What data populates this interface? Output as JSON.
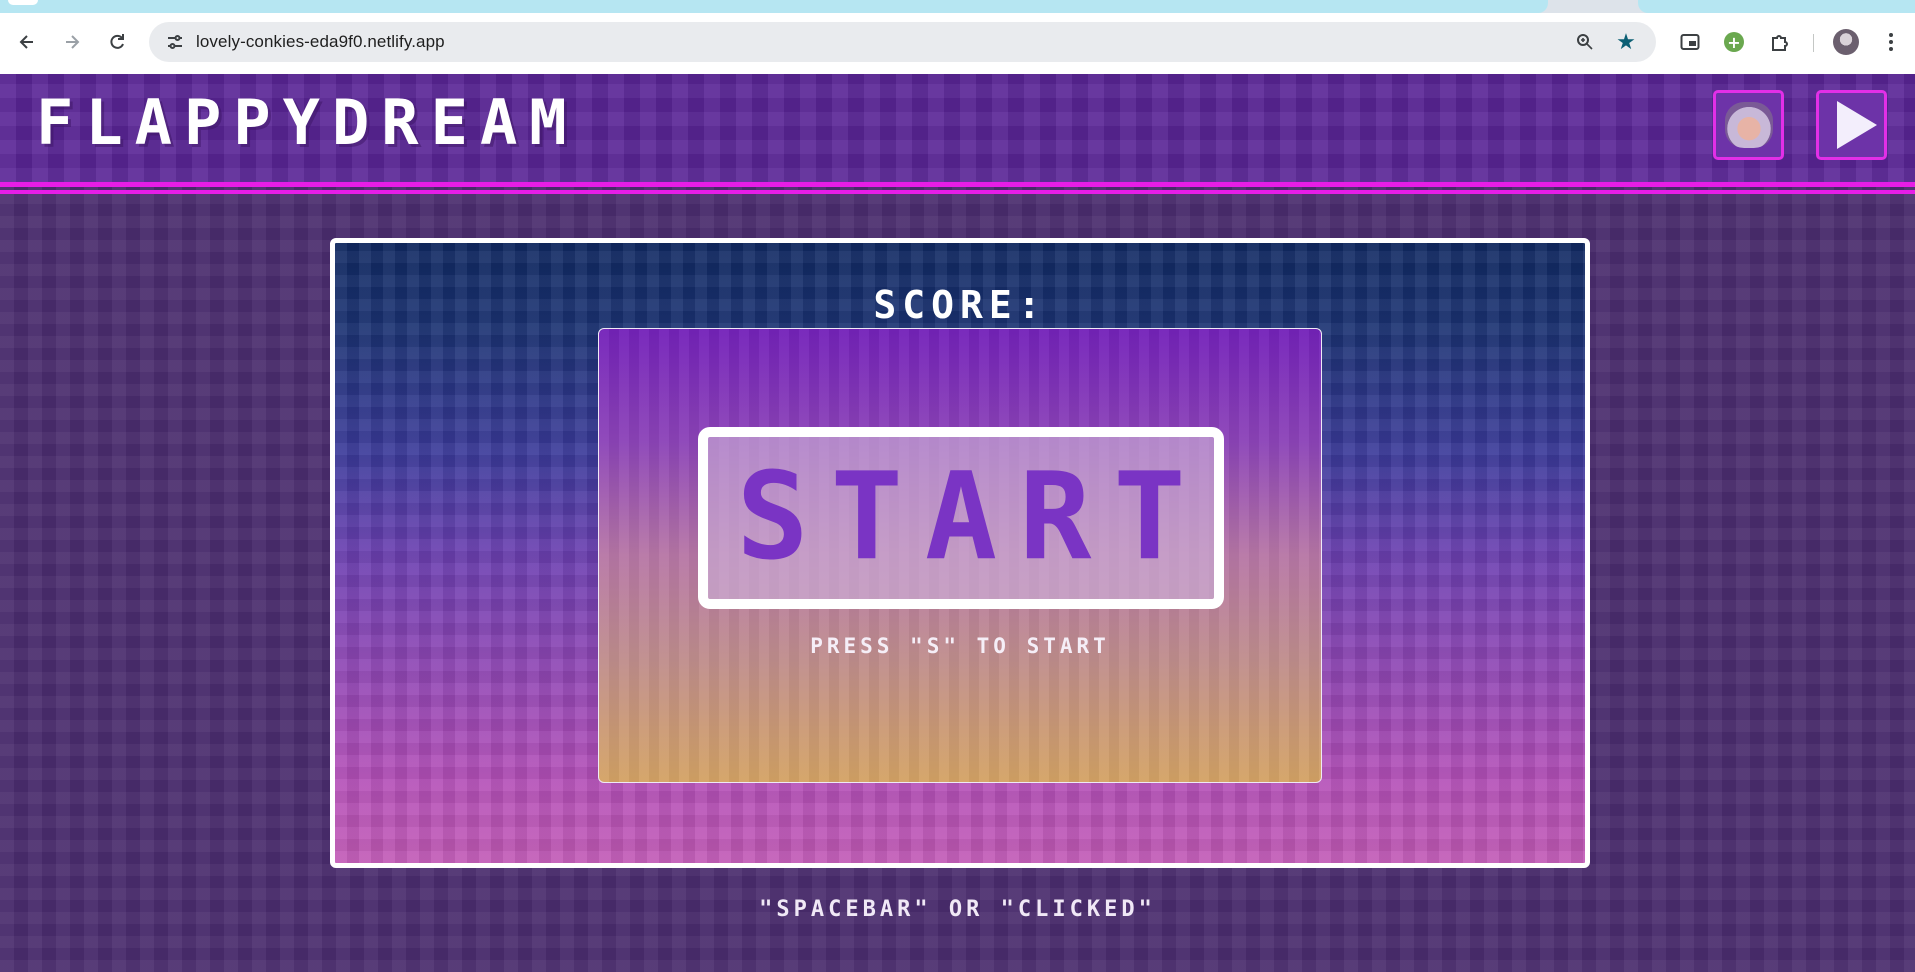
{
  "browser": {
    "url": "lovely-conkies-eda9f0.netlify.app",
    "icons": {
      "back": "arrow-left-icon",
      "forward": "arrow-right-icon",
      "reload": "reload-icon",
      "site_info": "tune-icon",
      "zoom": "zoom-icon",
      "bookmark": "star-icon",
      "pip": "picture-in-picture-icon",
      "extension_green": "plus-circle-icon",
      "extensions": "puzzle-icon",
      "menu": "kebab-menu-icon"
    },
    "colors": {
      "tab_strip": "#b6e6f2",
      "bookmark_star": "#0b5f74"
    }
  },
  "game": {
    "logo": "FLAPPYDREAM",
    "score_label": "SCORE:",
    "start_label": "START",
    "press_hint": "PRESS \"S\" TO START",
    "controls_hint": "\"SPACEBAR\" OR \"CLICKED\"",
    "buttons": {
      "character": "sheep-avatar-icon",
      "sound": "speaker-play-icon"
    },
    "colors": {
      "header_bg": "#5a2596",
      "header_accent": "#e61de6",
      "page_bg": "#4b2d6f",
      "start_text": "#7a34c4"
    }
  }
}
